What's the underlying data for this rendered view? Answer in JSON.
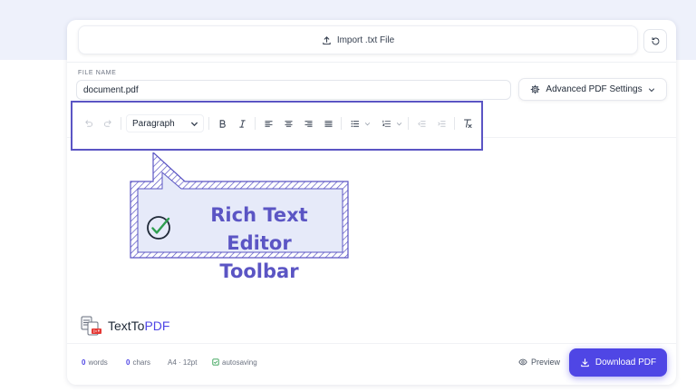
{
  "header": {
    "import_label": "Import .txt File"
  },
  "file": {
    "label": "FILE NAME",
    "value": "document.pdf"
  },
  "settings": {
    "advanced_label": "Advanced PDF Settings"
  },
  "toolbar": {
    "paragraph_value": "Paragraph",
    "clear_format_glyph": "T"
  },
  "callout": {
    "line1": "Rich Text Editor",
    "line2": "Toolbar"
  },
  "brand": {
    "name_part1": "TextTo",
    "name_part2": "PDF"
  },
  "footer": {
    "words_count": "0",
    "words_label": "words",
    "chars_count": "0",
    "chars_label": "chars",
    "page_format": "A4 · 12pt",
    "autosave_label": "autosaving",
    "preview_label": "Preview",
    "download_label": "Download PDF"
  },
  "colors": {
    "accent": "#4f46e5",
    "highlight_border": "#5b55c4",
    "callout_fill": "#e6eaf9",
    "check_green": "#2e9e4f"
  }
}
